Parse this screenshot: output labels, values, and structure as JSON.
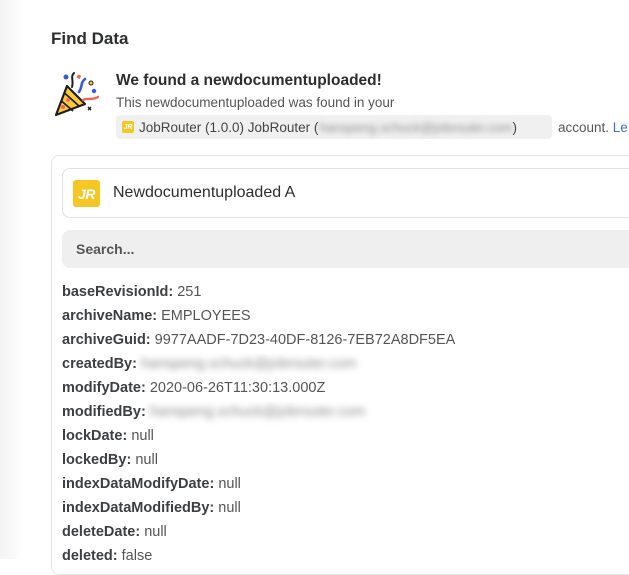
{
  "section_title": "Find Data",
  "result": {
    "heading": "We found a newdocumentuploaded!",
    "description": "This newdocumentuploaded was found in your",
    "account_app": "JobRouter (1.0.0) JobRouter (",
    "account_email_redacted": "hanspeng.schuck@jobrouter.com",
    "account_close": ")",
    "account_suffix": " account. ",
    "learn_link": "Le"
  },
  "sample": {
    "logo_text": "JR",
    "title": "Newdocumentuploaded A"
  },
  "search": {
    "placeholder": "Search..."
  },
  "fields": [
    {
      "key": "baseRevisionId:",
      "value": "251",
      "redacted": false
    },
    {
      "key": "archiveName:",
      "value": "EMPLOYEES",
      "redacted": false
    },
    {
      "key": "archiveGuid:",
      "value": "9977AADF-7D23-40DF-8126-7EB72A8DF5EA",
      "redacted": false
    },
    {
      "key": "createdBy:",
      "value": "hanspeng.schuck@jobrouter.com",
      "redacted": true
    },
    {
      "key": "modifyDate:",
      "value": "2020-06-26T11:30:13.000Z",
      "redacted": false
    },
    {
      "key": "modifiedBy:",
      "value": "hanspeng.schuck@jobrouter.com",
      "redacted": true
    },
    {
      "key": "lockDate:",
      "value": "null",
      "redacted": false
    },
    {
      "key": "lockedBy:",
      "value": "null",
      "redacted": false
    },
    {
      "key": "indexDataModifyDate:",
      "value": "null",
      "redacted": false
    },
    {
      "key": "indexDataModifiedBy:",
      "value": "null",
      "redacted": false
    },
    {
      "key": "deleteDate:",
      "value": "null",
      "redacted": false
    },
    {
      "key": "deleted:",
      "value": "false",
      "redacted": false
    }
  ],
  "colors": {
    "accent_yellow": "#f6c624",
    "link_blue": "#3d6bd8",
    "text_dark": "#2d2e2e"
  }
}
